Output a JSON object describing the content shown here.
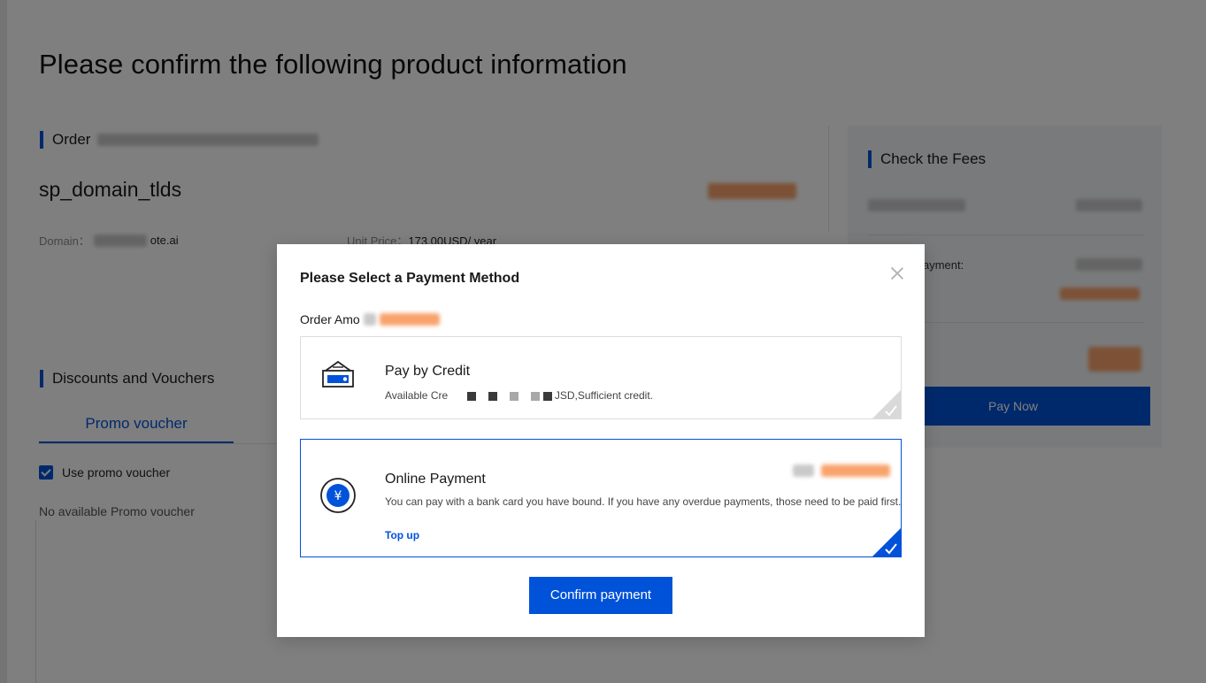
{
  "page": {
    "title": "Please confirm the following product information"
  },
  "order": {
    "label": "Order",
    "product_name": "sp_domain_tlds",
    "domain_label": "Domain：",
    "domain_value_suffix": "ote.ai",
    "unit_price_label": "Unit Price：",
    "unit_price_value": "173.00USD/ year"
  },
  "discounts": {
    "title": "Discounts and Vouchers",
    "tab_label": "Promo voucher",
    "use_promo_label": "Use promo voucher",
    "use_promo_checked": true,
    "empty_text": "No available Promo voucher"
  },
  "fees": {
    "title": "Check the Fees",
    "payment_label": "ayment:",
    "pay_now_label": "Pay Now"
  },
  "modal": {
    "title": "Please Select a Payment Method",
    "order_amount_label": "Order Amo",
    "options": [
      {
        "title": "Pay by Credit",
        "desc_prefix": "Available Cre",
        "desc_suffix": "JSD,Sufficient credit.",
        "selected": false
      },
      {
        "title": "Online Payment",
        "desc": "You can pay with a bank card you have bound. If you have any overdue payments, those need to be paid first.",
        "link_label": "Top up",
        "selected": true
      }
    ],
    "confirm_label": "Confirm payment"
  },
  "colors": {
    "accent": "#0052d9",
    "price_orange": "#f8a36c",
    "overlay": "rgba(0,0,0,0.5)"
  }
}
